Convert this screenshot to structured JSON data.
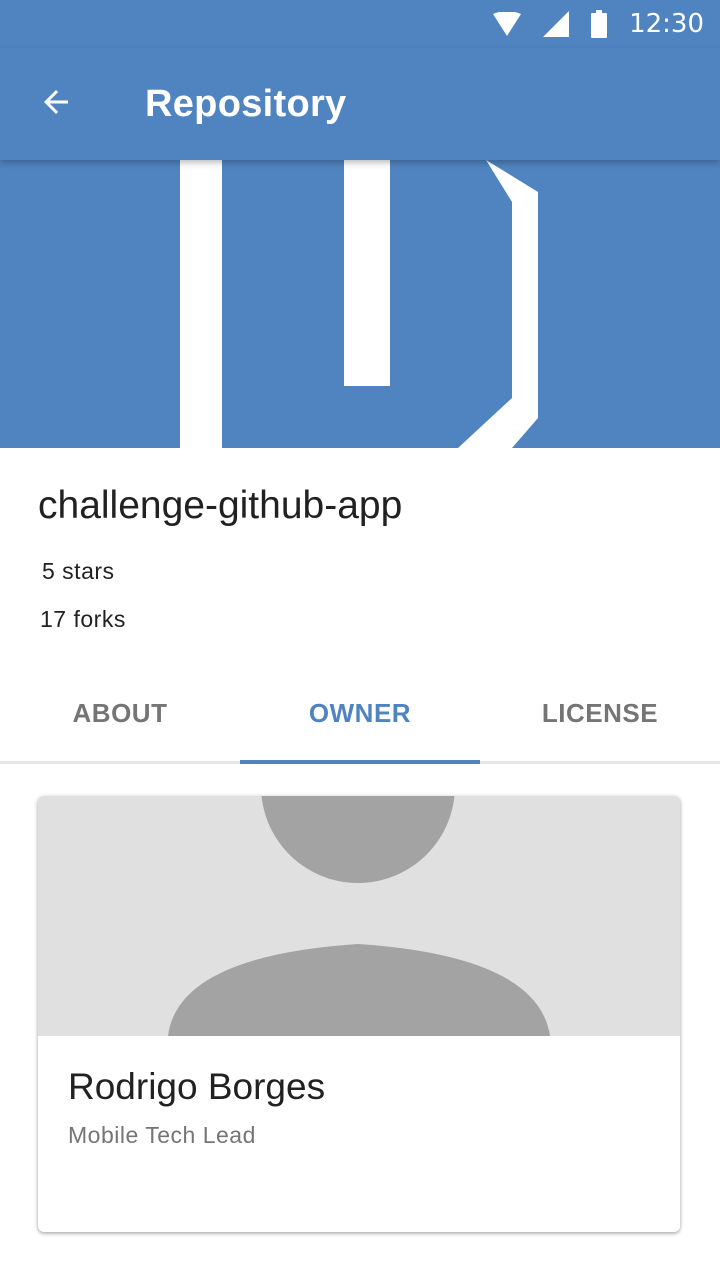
{
  "status_bar": {
    "time": "12:30",
    "icons": [
      "wifi-icon",
      "cell-signal-icon",
      "battery-icon"
    ]
  },
  "app_bar": {
    "title": "Repository",
    "back_icon": "arrow-back-icon"
  },
  "repository": {
    "name": "challenge-github-app",
    "stars": "5 stars",
    "forks": "17 forks"
  },
  "tabs": [
    {
      "label": "ABOUT",
      "active": false
    },
    {
      "label": "OWNER",
      "active": true
    },
    {
      "label": "LICENSE",
      "active": false
    }
  ],
  "owner": {
    "name": "Rodrigo Borges",
    "role": "Mobile Tech Lead",
    "avatar": "person-placeholder-icon"
  },
  "colors": {
    "primary": "#5084c1",
    "text_primary": "#212121",
    "text_secondary": "#757575",
    "placeholder_bg": "#e0e0e0",
    "placeholder_fg": "#a3a3a3"
  }
}
